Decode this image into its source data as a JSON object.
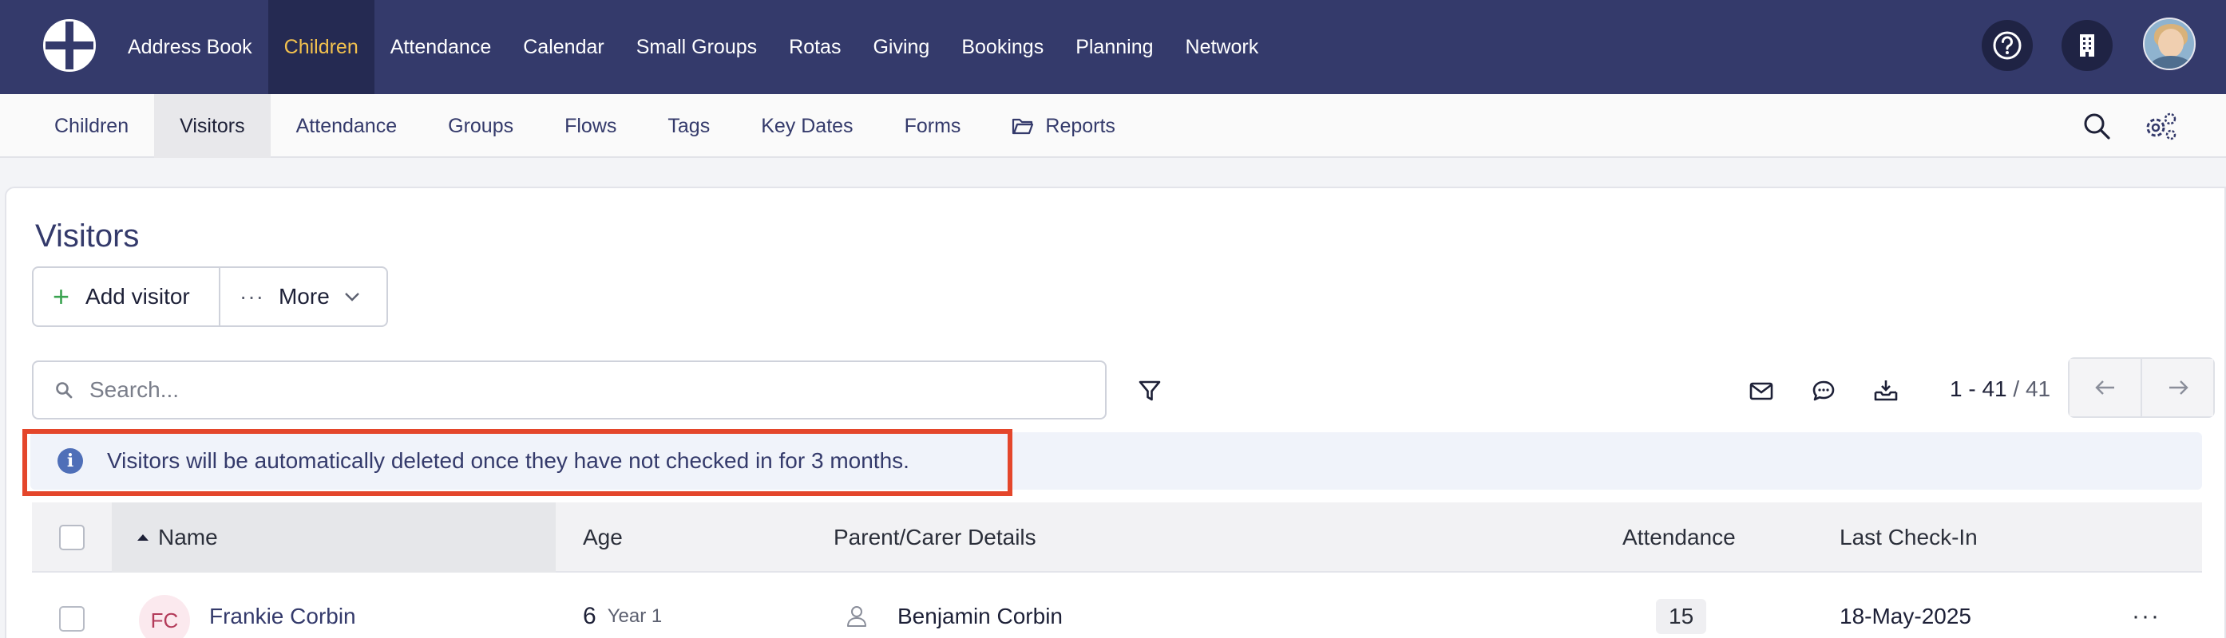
{
  "topnav": {
    "items": [
      {
        "label": "Address Book",
        "active": false
      },
      {
        "label": "Children",
        "active": true
      },
      {
        "label": "Attendance",
        "active": false
      },
      {
        "label": "Calendar",
        "active": false
      },
      {
        "label": "Small Groups",
        "active": false
      },
      {
        "label": "Rotas",
        "active": false
      },
      {
        "label": "Giving",
        "active": false
      },
      {
        "label": "Bookings",
        "active": false
      },
      {
        "label": "Planning",
        "active": false
      },
      {
        "label": "Network",
        "active": false
      }
    ],
    "icons": {
      "help": "question-circle-icon",
      "org": "building-icon",
      "avatar": "user-avatar"
    }
  },
  "subnav": {
    "items": [
      {
        "label": "Children",
        "active": false
      },
      {
        "label": "Visitors",
        "active": true
      },
      {
        "label": "Attendance",
        "active": false
      },
      {
        "label": "Groups",
        "active": false
      },
      {
        "label": "Flows",
        "active": false
      },
      {
        "label": "Tags",
        "active": false
      },
      {
        "label": "Key Dates",
        "active": false
      },
      {
        "label": "Forms",
        "active": false
      },
      {
        "label": "Reports",
        "active": false,
        "icon": "folder-icon"
      }
    ]
  },
  "page": {
    "title": "Visitors",
    "add_label": "Add visitor",
    "more_label": "More",
    "search_placeholder": "Search...",
    "pager_range": "1 - 41",
    "pager_total": "/ 41",
    "notice": "Visitors will be automatically deleted once they have not checked in for 3 months."
  },
  "table": {
    "columns": {
      "name": "Name",
      "age": "Age",
      "parent": "Parent/Carer Details",
      "attendance": "Attendance",
      "last_checkin": "Last Check-In"
    },
    "rows": [
      {
        "initials": "FC",
        "name": "Frankie Corbin",
        "age": "6",
        "year": "Year 1",
        "parent": "Benjamin Corbin",
        "attendance": "15",
        "last_checkin": "18-May-2025",
        "menu": "···"
      }
    ]
  },
  "colors": {
    "nav_bg": "#343a6b",
    "nav_active_bg": "#252a52",
    "nav_active_text": "#f2c14e",
    "accent_green": "#3aa350",
    "highlight_red": "#e4462b"
  }
}
